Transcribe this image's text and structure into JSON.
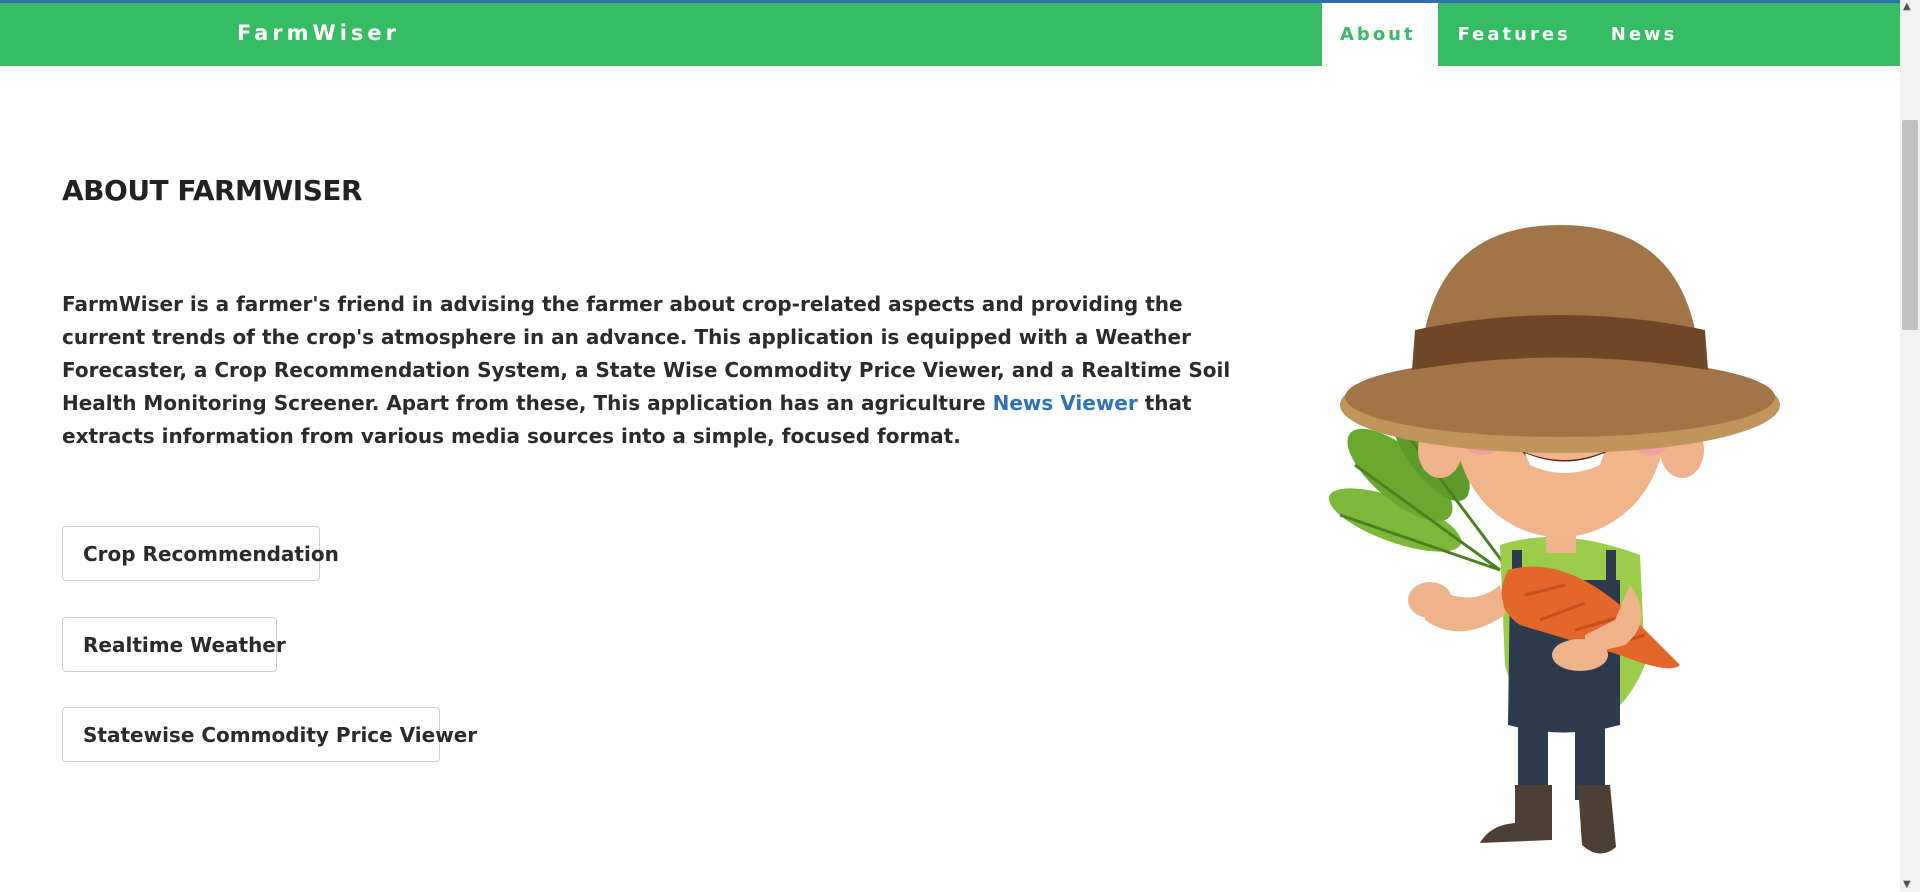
{
  "brand": "FarmWiser",
  "nav": [
    {
      "label": "About",
      "active": true
    },
    {
      "label": "Features",
      "active": false
    },
    {
      "label": "News",
      "active": false
    }
  ],
  "about": {
    "title": "ABOUT FARMWISER",
    "text_before": "FarmWiser is a farmer's friend in advising the farmer about crop-related aspects and providing the current trends of the crop's atmosphere in an advance. This application is equipped with a Weather Forecaster, a Crop Recommendation System, a State Wise Commodity Price Viewer, and a Realtime Soil Health Monitoring Screener. Apart from these, This application has an agriculture ",
    "link": "News Viewer",
    "text_after": " that extracts information from various media sources into a simple, focused format."
  },
  "buttons": [
    {
      "label": "Crop Recommendation"
    },
    {
      "label": "Realtime Weather"
    },
    {
      "label": "Statewise Commodity Price Viewer"
    }
  ],
  "colors": {
    "navbar": "#36bd63",
    "link": "#2f73b4",
    "topline": "#2f6fae"
  },
  "illustration": "farmer-holding-carrots-illustration"
}
